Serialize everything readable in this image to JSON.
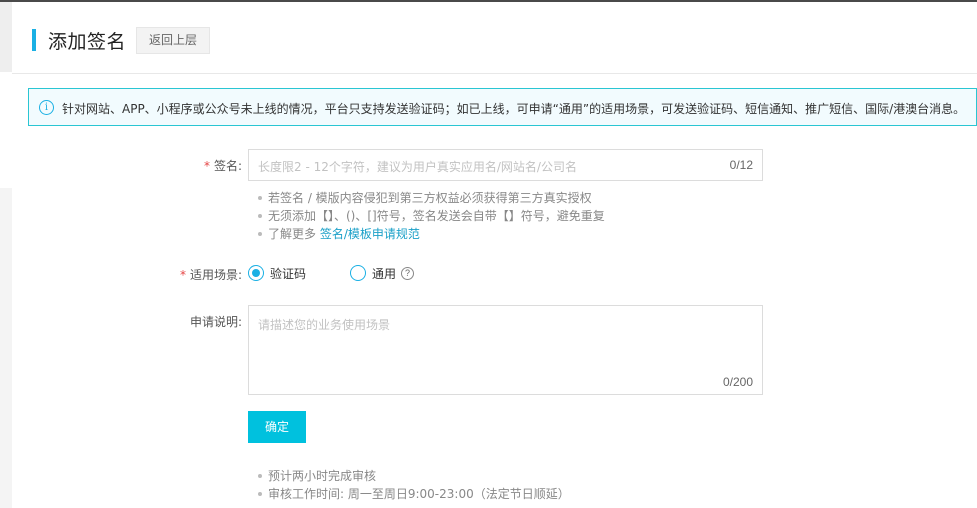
{
  "header": {
    "title": "添加签名",
    "back_label": "返回上层"
  },
  "notice": {
    "icon": "info-icon",
    "text": "针对网站、APP、小程序或公众号未上线的情况，平台只支持发送验证码；如已上线，可申请“通用”的适用场景，可发送验证码、短信通知、推广短信、国际/港澳台消息。"
  },
  "form": {
    "signature": {
      "label": "签名:",
      "placeholder": "长度限2 - 12个字符，建议为用户真实应用名/网站名/公司名",
      "counter": "0/12",
      "required_mark": "*"
    },
    "tips": [
      "若签名 / 模版内容侵犯到第三方权益必须获得第三方真实授权",
      "无须添加【】、()、[]符号，签名发送会自带【】符号，避免重复"
    ],
    "tip_more_prefix": "了解更多 ",
    "tip_more_link": "签名/模板申请规范",
    "scenario": {
      "label": "适用场景:",
      "required_mark": "*",
      "options": [
        {
          "label": "验证码",
          "checked": true
        },
        {
          "label": "通用",
          "checked": false
        }
      ],
      "help_icon": "?"
    },
    "description": {
      "label": "申请说明:",
      "placeholder": "请描述您的业务使用场景",
      "counter": "0/200"
    },
    "submit_label": "确定"
  },
  "footer_tips": [
    "预计两小时完成审核",
    "审核工作时间: 周一至周日9:00-23:00（法定节日顺延）"
  ],
  "colors": {
    "accent": "#1ab0e4",
    "button": "#00c1de",
    "notice_border": "#2ac6d3",
    "notice_bg": "#f2fbfe",
    "required": "#e54545",
    "link": "#1aa0c8"
  }
}
